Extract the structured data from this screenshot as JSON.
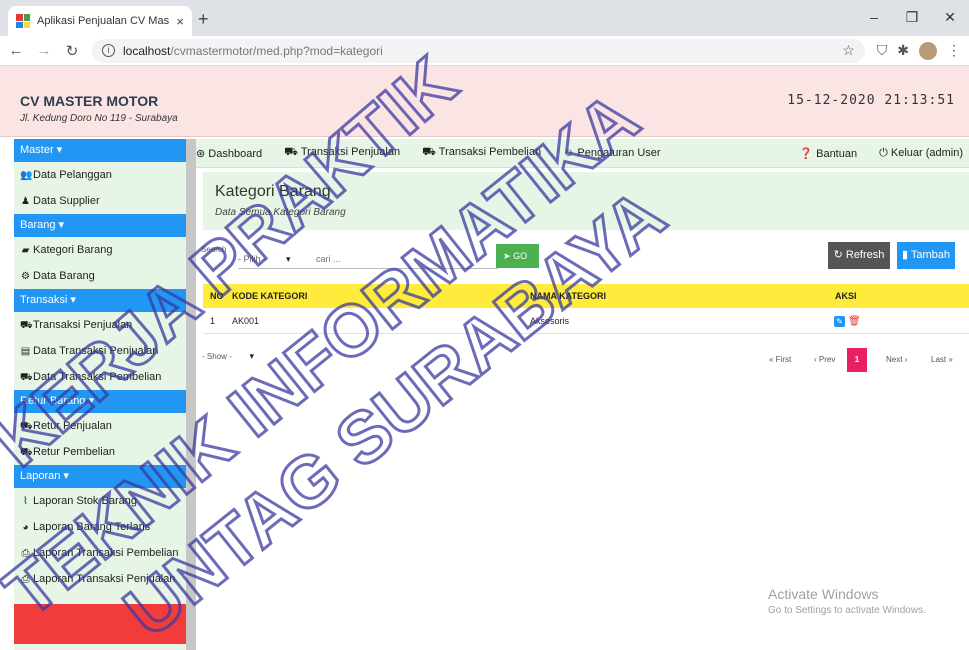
{
  "browser": {
    "tab_title": "Aplikasi Penjualan CV Master Mc",
    "tab_close": "×",
    "new_tab": "+",
    "win_min": "–",
    "win_max": "❐",
    "win_close": "✕",
    "url_host": "localhost",
    "url_path": "/cvmastermotor/med.php?mod=kategori"
  },
  "app": {
    "company": "CV MASTER MOTOR",
    "address": "Jl. Kedung Doro No 119 - Surabaya",
    "datetime": "15-12-2020 21:13:51"
  },
  "sidebar": {
    "sections": [
      {
        "label": "Master ▾",
        "items": [
          {
            "label": "Data Pelanggan",
            "icon": "users-icon",
            "glyph": "👥"
          },
          {
            "label": "Data Supplier",
            "icon": "user-icon",
            "glyph": "♟"
          }
        ]
      },
      {
        "label": "Barang ▾",
        "items": [
          {
            "label": "Kategori Barang",
            "icon": "folder-icon",
            "glyph": "▰"
          },
          {
            "label": "Data Barang",
            "icon": "cubes-icon",
            "glyph": "⚙"
          }
        ]
      },
      {
        "label": "Transaksi ▾",
        "items": [
          {
            "label": "Transaksi Penjualan",
            "icon": "cart-icon",
            "glyph": "⛟"
          },
          {
            "label": "Data Transaksi Penjualan",
            "icon": "book-icon",
            "glyph": "▤"
          },
          {
            "label": "Data Transaksi Pembelian",
            "icon": "truck-icon",
            "glyph": "⛟"
          }
        ]
      },
      {
        "label": "Retur Barang ▾",
        "items": [
          {
            "label": "Retur Penjualan",
            "icon": "cart-icon",
            "glyph": "⛟"
          },
          {
            "label": "Retur Pembelian",
            "icon": "cart-icon",
            "glyph": "⛟"
          }
        ]
      },
      {
        "label": "Laporan ▾",
        "items": [
          {
            "label": "Laporan Stok Barang",
            "icon": "line-chart-icon",
            "glyph": "⌇"
          },
          {
            "label": "Laporan Barang Terlaris",
            "icon": "pie-chart-icon",
            "glyph": "◕"
          },
          {
            "label": "Laporan Transaksi Pembelian",
            "icon": "print-icon",
            "glyph": "⎙"
          },
          {
            "label": "Laporan Transaksi Penjualan",
            "icon": "print-icon",
            "glyph": "⎙"
          }
        ]
      }
    ]
  },
  "topnav": {
    "dashboard": "Dashboard",
    "transaksi_penjualan": "Transaksi Penjualan",
    "transaksi_pembelian": "Transaksi Pembelian",
    "pengaturan_user": "Pengaturan User",
    "bantuan": "Bantuan",
    "keluar": "Keluar (admin)"
  },
  "page": {
    "title": "Kategori Barang",
    "subtitle": "Data Semua Kategori Barang"
  },
  "toolbar": {
    "search_label": "Search",
    "select_value": "- Pilih -",
    "search_placeholder": "cari ...",
    "go_label": "GO",
    "refresh_label": "Refresh",
    "tambah_label": "Tambah"
  },
  "table": {
    "headers": [
      "NO",
      "KODE KATEGORI",
      "NAMA KATEGORI",
      "AKSI"
    ],
    "rows": [
      {
        "no": "1",
        "kode": "AK001",
        "nama": "Aksesoris"
      }
    ]
  },
  "pagination": {
    "show_select": "- Show -",
    "first": "« First",
    "prev": "‹ Prev",
    "current": "1",
    "next": "Next ›",
    "last": "Last »"
  },
  "overlay": {
    "activate_title": "Activate Windows",
    "activate_sub": "Go to Settings to activate Windows."
  },
  "watermark": {
    "lines": [
      "KERJA PRAKTIK",
      "TEKNIK INFORMATIKA",
      "UNTAG SURABAYA"
    ],
    "color": "#3a3aa0"
  }
}
